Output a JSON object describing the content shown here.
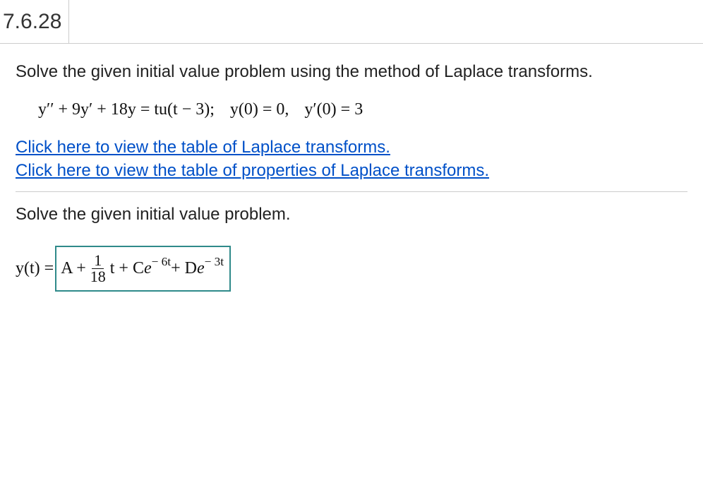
{
  "header": {
    "problem_number": "7.6.28"
  },
  "problem": {
    "statement": "Solve the given initial value problem using the method of Laplace transforms.",
    "equation": {
      "ode_lhs_y2prime": "y′′",
      "ode_plus1": " + 9",
      "ode_yprime": "y′",
      "ode_plus2": " + 18y = tu(t − 3);",
      "ic1": "y(0) = 0,",
      "ic2_y": "y′",
      "ic2_rest": "(0) = 3"
    }
  },
  "links": {
    "laplace_table": "Click here to view the table of Laplace transforms.",
    "laplace_properties": "Click here to view the table of properties of Laplace transforms."
  },
  "prompt": "Solve the given initial value problem.",
  "answer": {
    "prefix": "y(t) = ",
    "box": {
      "part_A": "A + ",
      "frac_num": "1",
      "frac_den": "18",
      "part_t": "t + C",
      "e1_base": " e",
      "e1_exp": " − 6t",
      "plus_D": " + D",
      "e2_base": " e",
      "e2_exp": " − 3t"
    }
  }
}
